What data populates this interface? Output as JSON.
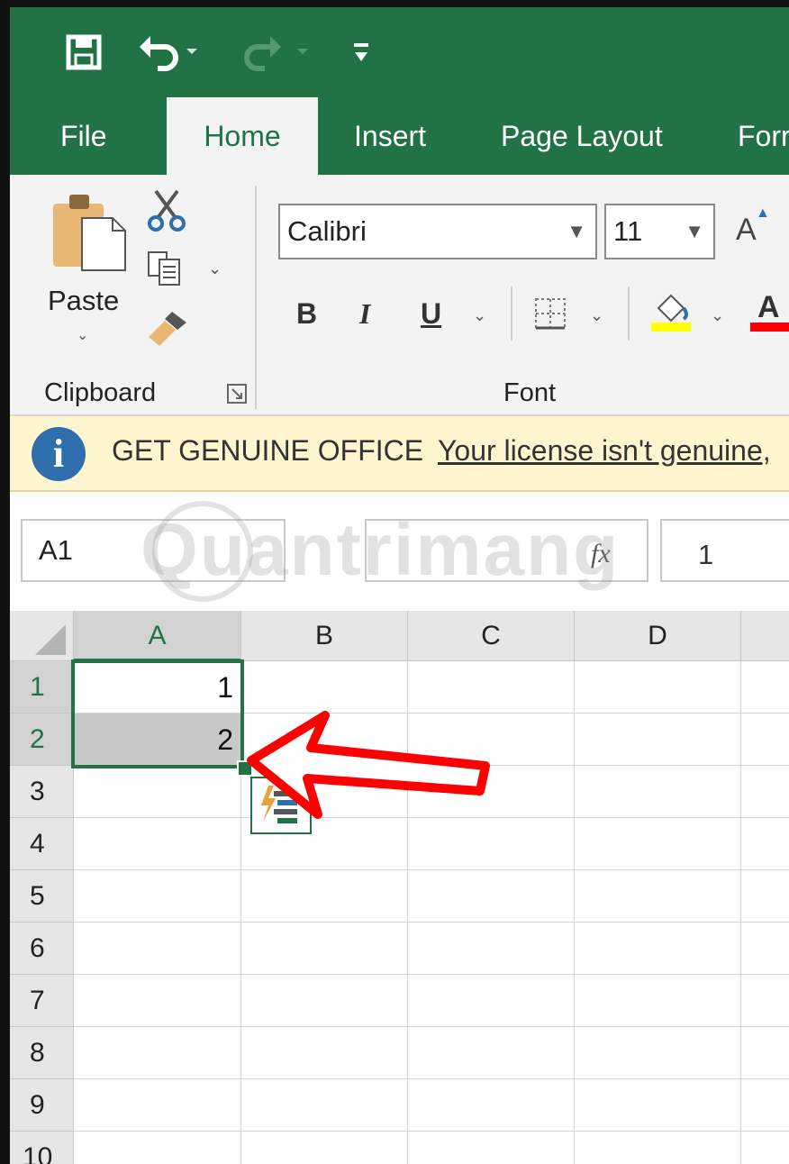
{
  "quick_access": {
    "save_icon": "save-icon",
    "undo_icon": "undo-icon",
    "redo_icon": "redo-icon",
    "customize_icon": "customize-qat-icon"
  },
  "tabs": [
    {
      "label": "File"
    },
    {
      "label": "Home"
    },
    {
      "label": "Insert"
    },
    {
      "label": "Page Layout"
    },
    {
      "label": "Forr"
    }
  ],
  "ribbon": {
    "clipboard": {
      "paste_label": "Paste",
      "group_label": "Clipboard"
    },
    "font": {
      "font_name": "Calibri",
      "font_size": "11",
      "grow_label": "A",
      "bold": "B",
      "italic": "I",
      "underline": "U",
      "font_color_label": "A",
      "group_label": "Font",
      "highlight_color": "#ffff00",
      "font_color": "#ff0000"
    }
  },
  "infobar": {
    "title": "GET GENUINE OFFICE",
    "link": "Your license isn't genuine,"
  },
  "formula_bar": {
    "name_box": "A1",
    "fx": "fx",
    "content": "1",
    "watermark": "Quantrimang"
  },
  "grid": {
    "columns": [
      "A",
      "B",
      "C",
      "D"
    ],
    "rows": [
      "1",
      "2",
      "3",
      "4",
      "5",
      "6",
      "7",
      "8",
      "9",
      "10"
    ],
    "cells": {
      "A1": "1",
      "A2": "2"
    }
  },
  "colors": {
    "accent": "#217346",
    "annotation_arrow": "#ff0000"
  }
}
